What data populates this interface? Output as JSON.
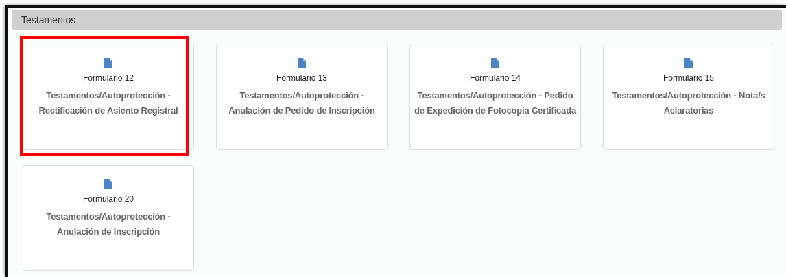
{
  "panel": {
    "title": "Testamentos"
  },
  "cards": [
    {
      "form": "Formulario 12",
      "title": "Testamentos/Autoprotección - Rectificación de Asiento Registral",
      "highlighted": true
    },
    {
      "form": "Formulario 13",
      "title": "Testamentos/Autoprotección - Anulación de Pedido de Inscripción",
      "highlighted": false
    },
    {
      "form": "Formulario 14",
      "title": "Testamentos/Autoprotección - Pedido de Expedición de Fotocopia Certificada",
      "highlighted": false
    },
    {
      "form": "Formulario 15",
      "title": "Testamentos/Autoprotección - Nota/s Aclaratorias",
      "highlighted": false
    },
    {
      "form": "Formulario 20",
      "title": "Testamentos/Autoprotección - Anulación de Inscripción",
      "highlighted": false
    }
  ]
}
